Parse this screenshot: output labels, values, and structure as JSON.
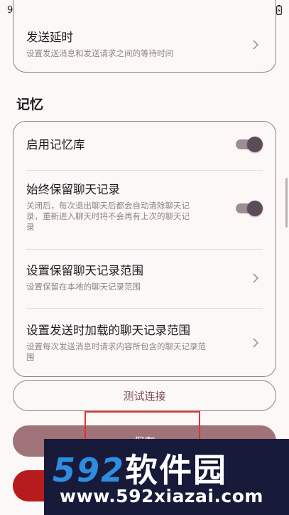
{
  "status_bar": {
    "time": "9:22"
  },
  "top_group": {
    "item_send_delay": {
      "title": "发送延时",
      "subtitle": "设置发送消息和发送请求之间的等待时间"
    }
  },
  "memory_section": {
    "title": "记忆",
    "items": [
      {
        "title": "启用记忆库",
        "subtitle": "",
        "toggle_on": true
      },
      {
        "title": "始终保留聊天记录",
        "subtitle_line1": "关闭后，每次退出聊天后都会自动清除聊天记",
        "subtitle_line2": "录，重新进入聊天时将不会再有上次的聊天记",
        "subtitle_line3": "录",
        "toggle_on": true
      },
      {
        "title": "设置保留聊天记录范围",
        "subtitle": "设置保留在本地的聊天记录范围"
      },
      {
        "title": "设置发送时加载的聊天记录范围",
        "subtitle_line1": "设置每次发送消息时请求内容所包含的聊天记录范",
        "subtitle_line2": "围"
      }
    ]
  },
  "buttons": {
    "test_connection": "测试连接",
    "save": "保存"
  },
  "watermark": {
    "brand_number": "592",
    "brand_text": "软件园",
    "url": "www.592xiazai.com"
  },
  "colors": {
    "background": "#fdf8f8",
    "accent": "#7b4f5c",
    "save_button": "#9f7378",
    "danger_button": "#b71c1c",
    "toggle_thumb": "#5b4c58"
  }
}
